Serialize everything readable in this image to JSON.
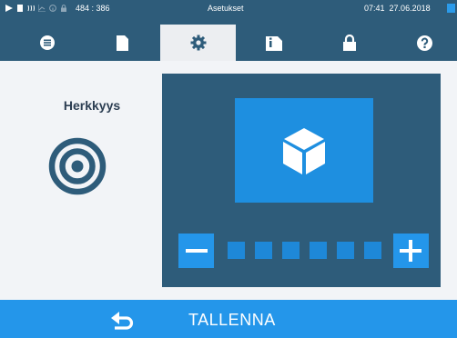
{
  "status_bar": {
    "coordinates": "484 : 386",
    "title": "Asetukset",
    "time": "07:41",
    "date": "27.06.2018",
    "icons": [
      "play-icon",
      "document-icon",
      "steam-icon",
      "chart-icon",
      "info-circle-icon",
      "lock-icon"
    ]
  },
  "tabs": [
    {
      "name": "menu-list-icon",
      "active": false
    },
    {
      "name": "document-icon",
      "active": false
    },
    {
      "name": "gear-icon",
      "active": true
    },
    {
      "name": "info-document-icon",
      "active": false
    },
    {
      "name": "lock-icon",
      "active": false
    },
    {
      "name": "help-icon",
      "active": false
    }
  ],
  "sensitivity": {
    "title": "Herkkyys",
    "level": 6,
    "max_level": 6
  },
  "bottom_bar": {
    "save_label": "TALLENNA"
  },
  "colors": {
    "dark_blue": "#2e5c7a",
    "accent_blue": "#2496ea",
    "tile_blue": "#1e8fe0",
    "text_dark": "#2c3e52"
  }
}
